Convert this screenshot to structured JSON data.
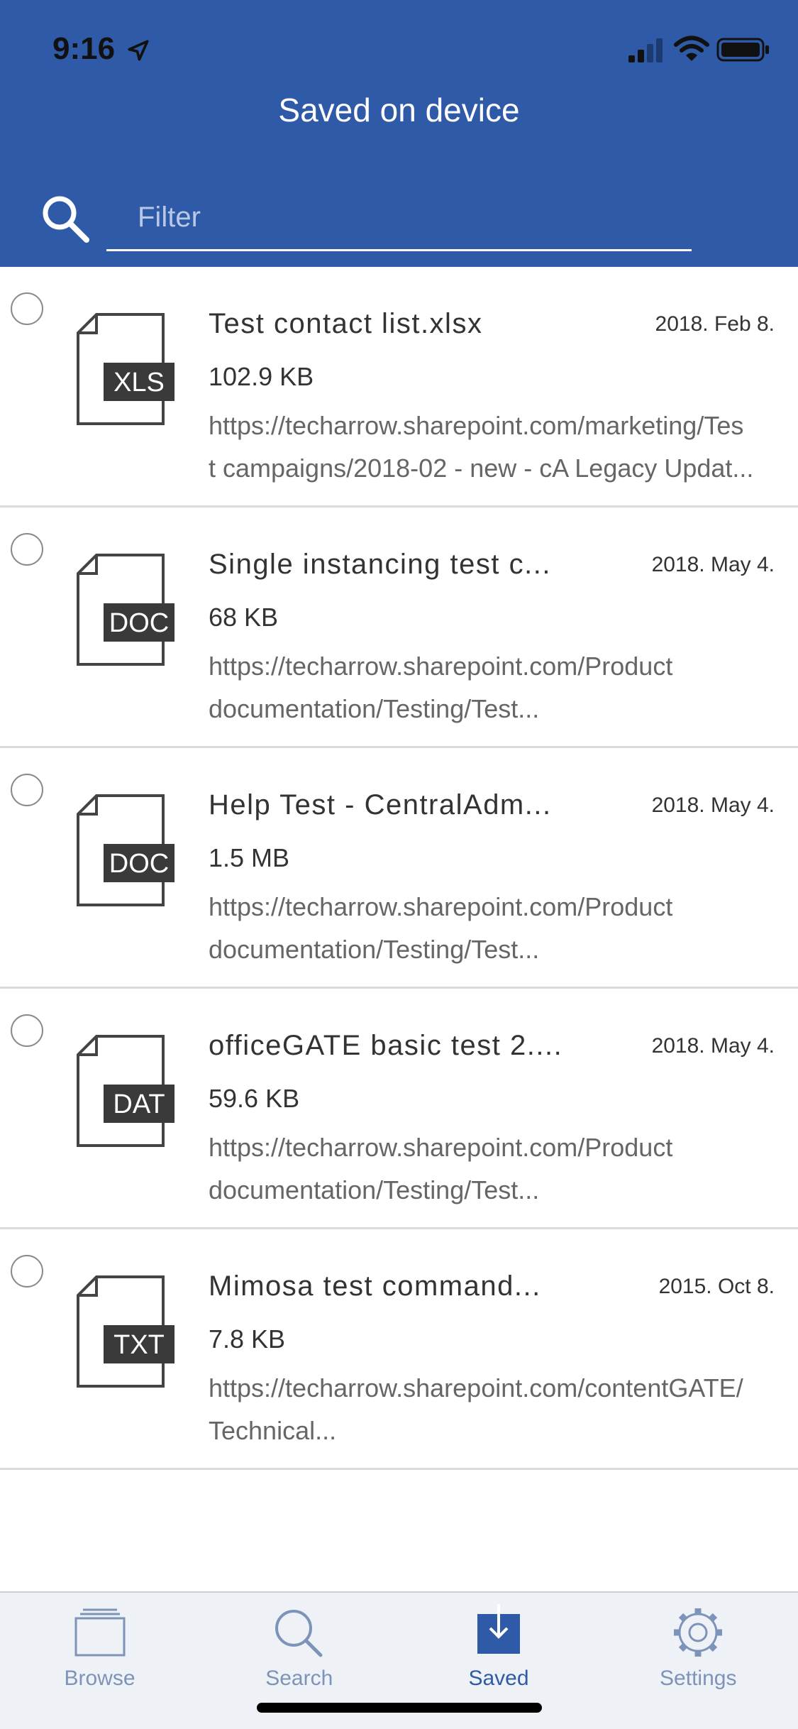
{
  "status": {
    "time": "9:16"
  },
  "header": {
    "title": "Saved on device"
  },
  "filter": {
    "placeholder": "Filter",
    "value": ""
  },
  "files": [
    {
      "type": "XLS",
      "name": "Test contact list.xlsx",
      "date": "2018. Feb 8.",
      "size": "102.9 KB",
      "path_line1": "https://techarrow.sharepoint.com/marketing/Tes",
      "path_line2": "t campaigns/2018-02 - new - cA Legacy Updat..."
    },
    {
      "type": "DOC",
      "name": "Single instancing test c...",
      "date": "2018. May 4.",
      "size": "68 KB",
      "path_line1": "https://techarrow.sharepoint.com/Product",
      "path_line2": "documentation/Testing/Test..."
    },
    {
      "type": "DOC",
      "name": "Help Test - CentralAdm...",
      "date": "2018. May 4.",
      "size": "1.5 MB",
      "path_line1": "https://techarrow.sharepoint.com/Product",
      "path_line2": "documentation/Testing/Test..."
    },
    {
      "type": "DAT",
      "name": "officeGATE basic test 2....",
      "date": "2018. May 4.",
      "size": "59.6 KB",
      "path_line1": "https://techarrow.sharepoint.com/Product",
      "path_line2": "documentation/Testing/Test..."
    },
    {
      "type": "TXT",
      "name": "Mimosa test command...",
      "date": "2015. Oct 8.",
      "size": "7.8 KB",
      "path_line1": "https://techarrow.sharepoint.com/contentGATE/",
      "path_line2": "Technical..."
    }
  ],
  "tabs": [
    {
      "label": "Browse",
      "icon": "folder-icon",
      "active": false
    },
    {
      "label": "Search",
      "icon": "search-icon",
      "active": false
    },
    {
      "label": "Saved",
      "icon": "download-icon",
      "active": true
    },
    {
      "label": "Settings",
      "icon": "gear-icon",
      "active": false
    }
  ],
  "colors": {
    "primary": "#2f5aa8",
    "tab_inactive": "#7d93b8",
    "divider": "#dadada"
  }
}
